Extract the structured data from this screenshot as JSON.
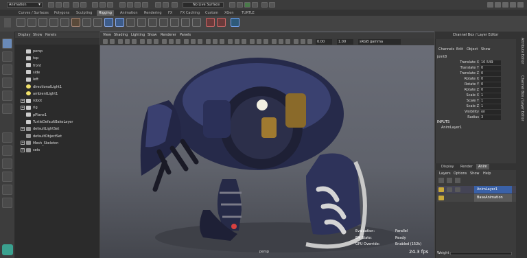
{
  "menubar": {
    "mode": "Animation",
    "live_surface": "No Live Surface"
  },
  "shelf_tabs": [
    {
      "label": "Curves / Surfaces",
      "active": false
    },
    {
      "label": "Polygons",
      "active": false
    },
    {
      "label": "Sculpting",
      "active": false
    },
    {
      "label": "Rigging",
      "active": true
    },
    {
      "label": "Animation",
      "active": false
    },
    {
      "label": "Rendering",
      "active": false
    },
    {
      "label": "FX",
      "active": false
    },
    {
      "label": "FX Caching",
      "active": false
    },
    {
      "label": "Custom",
      "active": false
    },
    {
      "label": "XGen",
      "active": false
    },
    {
      "label": "TURTLE",
      "active": false
    }
  ],
  "outliner": {
    "menu": [
      "Display",
      "Show",
      "Panels"
    ],
    "items": [
      {
        "label": "persp",
        "icon": "camera-icon",
        "expand": ""
      },
      {
        "label": "top",
        "icon": "camera-icon",
        "expand": ""
      },
      {
        "label": "front",
        "icon": "camera-icon",
        "expand": ""
      },
      {
        "label": "side",
        "icon": "camera-icon",
        "expand": ""
      },
      {
        "label": "left",
        "icon": "camera-icon",
        "expand": ""
      },
      {
        "label": "directionalLight1",
        "icon": "light-icon",
        "expand": ""
      },
      {
        "label": "ambientLight1",
        "icon": "light-icon",
        "expand": ""
      },
      {
        "label": "robot",
        "icon": "group-icon",
        "expand": "+"
      },
      {
        "label": "rig",
        "icon": "group-icon",
        "expand": "+"
      },
      {
        "label": "pPlane1",
        "icon": "mesh-icon",
        "expand": ""
      },
      {
        "label": "TurtleDefaultBakeLayer",
        "icon": "node-icon",
        "expand": ""
      },
      {
        "label": "defaultLightSet",
        "icon": "set-icon",
        "expand": "+"
      },
      {
        "label": "defaultObjectSet",
        "icon": "set-icon",
        "expand": ""
      },
      {
        "label": "Mesh_Skeleton",
        "icon": "set-icon",
        "expand": "+"
      },
      {
        "label": "sets",
        "icon": "set-icon",
        "expand": "+"
      }
    ]
  },
  "viewport": {
    "menu": [
      "View",
      "Shading",
      "Lighting",
      "Show",
      "Renderer",
      "Panels"
    ],
    "field1": "0.00",
    "field2": "1.00",
    "color_space": "sRGB gamma",
    "camera": "persp",
    "fps": "24.3 fps",
    "hud": [
      {
        "label": "Evaluation:",
        "value": "Parallel"
      },
      {
        "label": "EM State:",
        "value": "Ready"
      },
      {
        "label": "GPU Override:",
        "value": "Enabled (152k)"
      }
    ]
  },
  "channel_box": {
    "title": "Channel Box / Layer Editor",
    "menu": [
      "Channels",
      "Edit",
      "Object",
      "Show"
    ],
    "object": "joint8",
    "channels": [
      {
        "label": "Translate X",
        "value": "10.549"
      },
      {
        "label": "Translate Y",
        "value": "0"
      },
      {
        "label": "Translate Z",
        "value": "0"
      },
      {
        "label": "Rotate X",
        "value": "0"
      },
      {
        "label": "Rotate Y",
        "value": "0"
      },
      {
        "label": "Rotate Z",
        "value": "0"
      },
      {
        "label": "Scale X",
        "value": "1"
      },
      {
        "label": "Scale Y",
        "value": "1"
      },
      {
        "label": "Scale Z",
        "value": "1"
      },
      {
        "label": "Visibility",
        "value": "on"
      },
      {
        "label": "Radius",
        "value": "3"
      }
    ],
    "inputs_label": "INPUTS",
    "input_item": "AnimLayer1"
  },
  "layer_editor": {
    "tabs": [
      {
        "label": "Display",
        "active": false
      },
      {
        "label": "Render",
        "active": false
      },
      {
        "label": "Anim",
        "active": true
      }
    ],
    "menu": [
      "Layers",
      "Options",
      "Show",
      "Help"
    ],
    "layers": [
      "AnimLayer1",
      "BaseAnimation"
    ],
    "weight_label": "Weight"
  },
  "side_strip": {
    "labels": [
      "Attribute Editor",
      "Channel Box / Layer Editor"
    ]
  }
}
